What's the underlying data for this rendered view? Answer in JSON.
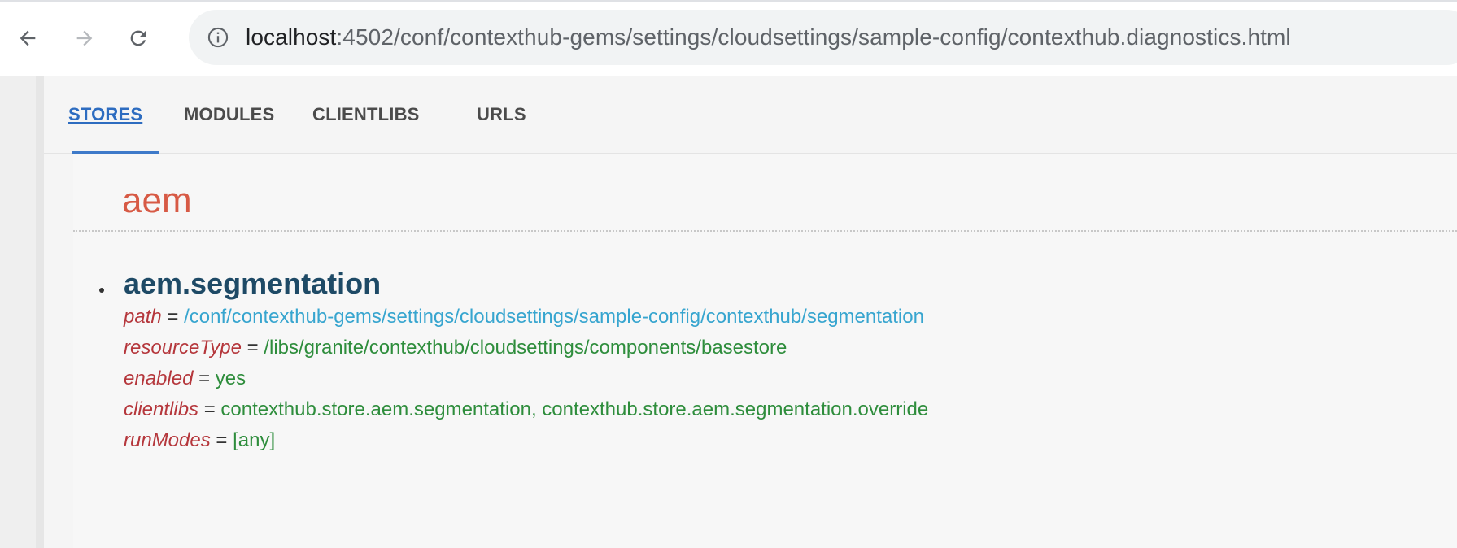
{
  "browser": {
    "url_host": "localhost",
    "url_rest": ":4502/conf/contexthub-gems/settings/cloudsettings/sample-config/contexthub.diagnostics.html",
    "icons": [
      "back-arrow-icon",
      "forward-arrow-icon",
      "reload-icon",
      "info-icon"
    ]
  },
  "tabs": [
    {
      "label": "STORES",
      "active": true
    },
    {
      "label": "MODULES",
      "active": false
    },
    {
      "label": "CLIENTLIBS",
      "active": false
    },
    {
      "label": "URLS",
      "active": false
    }
  ],
  "store_group": {
    "title": "aem",
    "stores": [
      {
        "name": "aem.segmentation",
        "properties": [
          {
            "key": "path",
            "eq": " = ",
            "value": "/conf/contexthub-gems/settings/cloudsettings/sample-config/contexthub/segmentation"
          },
          {
            "key": "resourceType",
            "eq": " = ",
            "value": "/libs/granite/contexthub/cloudsettings/components/basestore"
          },
          {
            "key": "enabled",
            "eq": " = ",
            "value": "yes"
          },
          {
            "key": "clientlibs",
            "eq": " = ",
            "value": "contexthub.store.aem.segmentation, contexthub.store.aem.segmentation.override"
          },
          {
            "key": "runModes",
            "eq": " = ",
            "value": "[any]"
          }
        ]
      }
    ]
  },
  "colors": {
    "active_tab": "#2d6cc0",
    "store_title": "#d75a45",
    "store_name": "#1e4a66",
    "prop_key": "#b5373c",
    "path_value": "#37a5cf",
    "value": "#2e8d3c"
  }
}
